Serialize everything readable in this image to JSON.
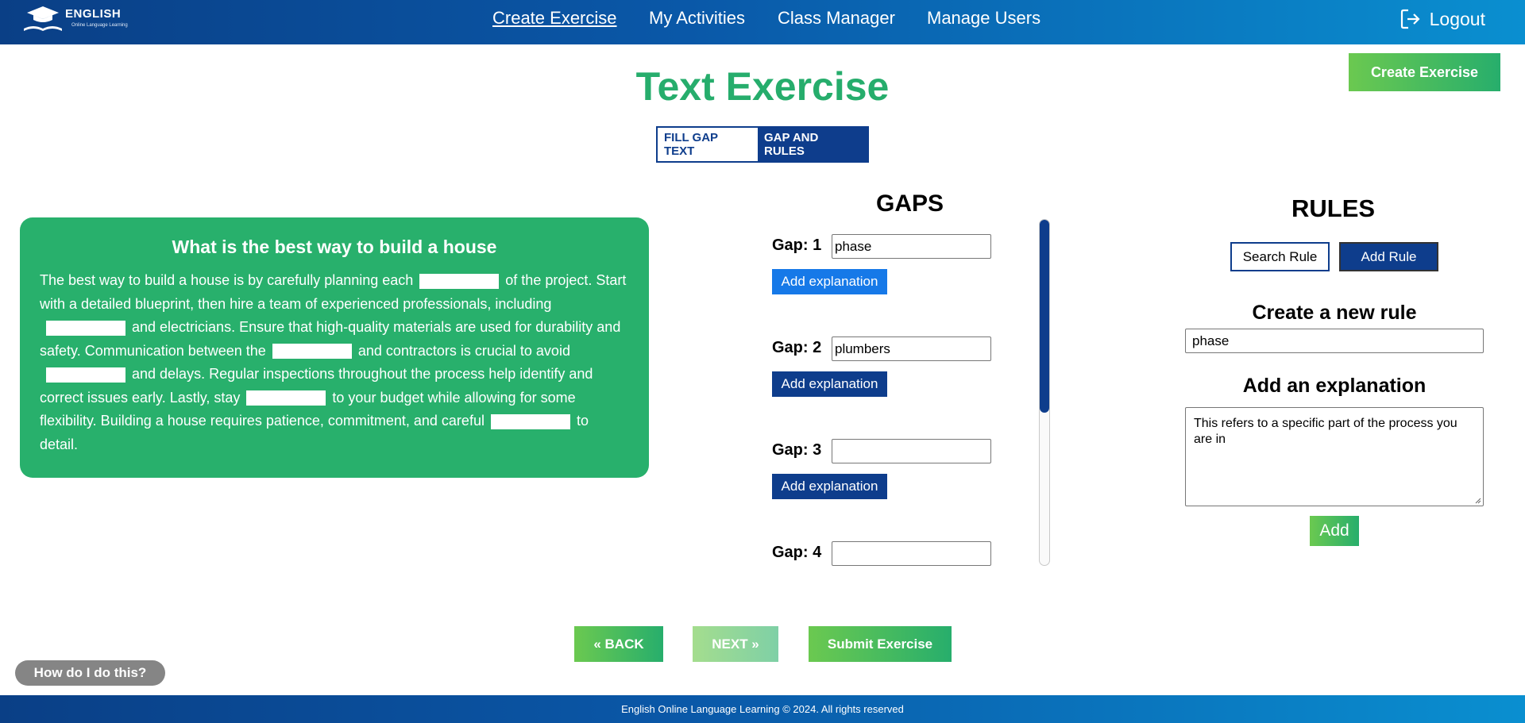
{
  "header": {
    "logo_title": "ENGLISH",
    "logo_subtitle": "Online Language Learning",
    "nav": [
      "Create Exercise",
      "My Activities",
      "Class Manager",
      "Manage Users"
    ],
    "logout_label": "Logout"
  },
  "page": {
    "title": "Text Exercise",
    "create_button": "Create Exercise",
    "tabs": [
      "FILL GAP TEXT",
      "GAP AND RULES"
    ]
  },
  "text_card": {
    "heading": "What is the best way to build a house",
    "segments": [
      "The best way to build a house is by carefully planning each",
      "of the project. Start with a detailed blueprint, then hire a team of experienced professionals, including",
      "and electricians. Ensure that high-quality materials are used for durability and safety. Communication between the",
      "and contractors is crucial to avoid",
      "and delays. Regular inspections throughout the process help identify and correct issues early. Lastly, stay",
      "to your budget while allowing for some flexibility. Building a house requires patience, commitment, and careful",
      "to detail."
    ]
  },
  "gaps": {
    "title": "GAPS",
    "items": [
      {
        "label": "Gap: 1",
        "value": "phase",
        "button": "Add explanation"
      },
      {
        "label": "Gap: 2",
        "value": "plumbers",
        "button": "Add explanation"
      },
      {
        "label": "Gap: 3",
        "value": "",
        "button": "Add explanation"
      },
      {
        "label": "Gap: 4",
        "value": ""
      }
    ]
  },
  "rules": {
    "title": "RULES",
    "search_button": "Search Rule",
    "add_rule_button": "Add Rule",
    "create_title": "Create a new rule",
    "rule_value": "phase",
    "explanation_title": "Add an explanation",
    "explanation_value": "This refers to a specific part of the process you are in",
    "add_button": "Add"
  },
  "bottom": {
    "back": "« BACK",
    "next": "NEXT »",
    "submit": "Submit Exercise",
    "help": "How do I do this?"
  },
  "footer": {
    "text": "English Online Language Learning © 2024. All rights reserved"
  },
  "colors": {
    "brand_blue": "#0e3d8c",
    "brand_green": "#26ad6c",
    "link_blue": "#1679e8"
  }
}
